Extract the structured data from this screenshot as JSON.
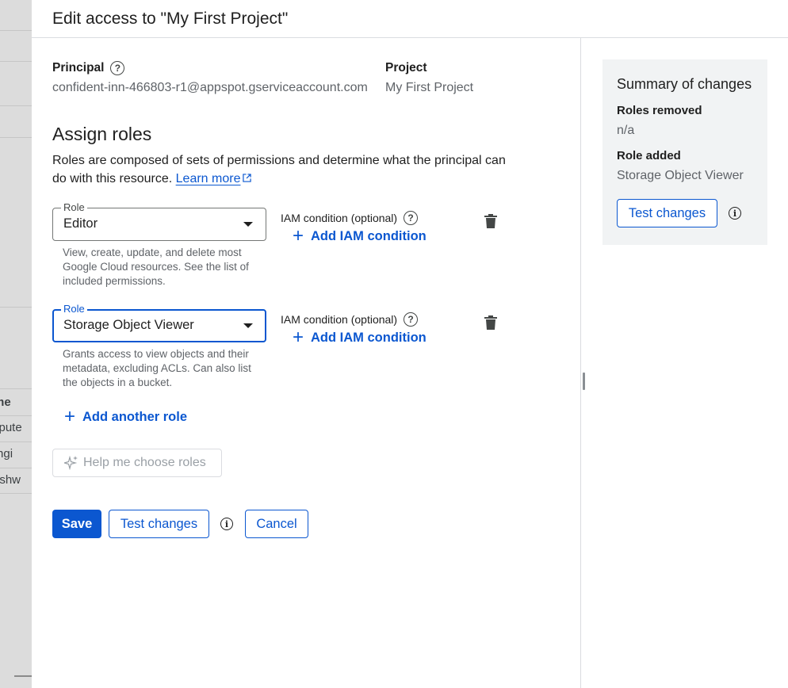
{
  "background": {
    "column_header": "me",
    "rows": [
      "mpute",
      "Engi",
      "reshw"
    ]
  },
  "panel": {
    "title": "Edit access to \"My First Project\""
  },
  "principal": {
    "label": "Principal",
    "value": "confident-inn-466803-r1@appspot.gserviceaccount.com"
  },
  "project": {
    "label": "Project",
    "value": "My First Project"
  },
  "assign_roles": {
    "title": "Assign roles",
    "description": "Roles are composed of sets of permissions and determine what the principal can do with this resource.",
    "learn_more": "Learn more"
  },
  "roles": [
    {
      "field_label": "Role",
      "value": "Editor",
      "description": "View, create, update, and delete most Google Cloud resources. See the list of included permissions.",
      "iam_label": "IAM condition (optional)",
      "add_condition": "Add IAM condition"
    },
    {
      "field_label": "Role",
      "value": "Storage Object Viewer",
      "description": "Grants access to view objects and their metadata, excluding ACLs. Can also list the objects in a bucket.",
      "iam_label": "IAM condition (optional)",
      "add_condition": "Add IAM condition"
    }
  ],
  "actions": {
    "add_another_role": "Add another role",
    "help_choose": "Help me choose roles",
    "save": "Save",
    "test_changes": "Test changes",
    "cancel": "Cancel"
  },
  "summary": {
    "title": "Summary of changes",
    "roles_removed_label": "Roles removed",
    "roles_removed_value": "n/a",
    "role_added_label": "Role added",
    "role_added_value": "Storage Object Viewer",
    "test_changes": "Test changes"
  },
  "colors": {
    "primary": "#0b57d0",
    "summary_bg": "#f1f3f4",
    "backdrop": "#dcdcdc"
  }
}
